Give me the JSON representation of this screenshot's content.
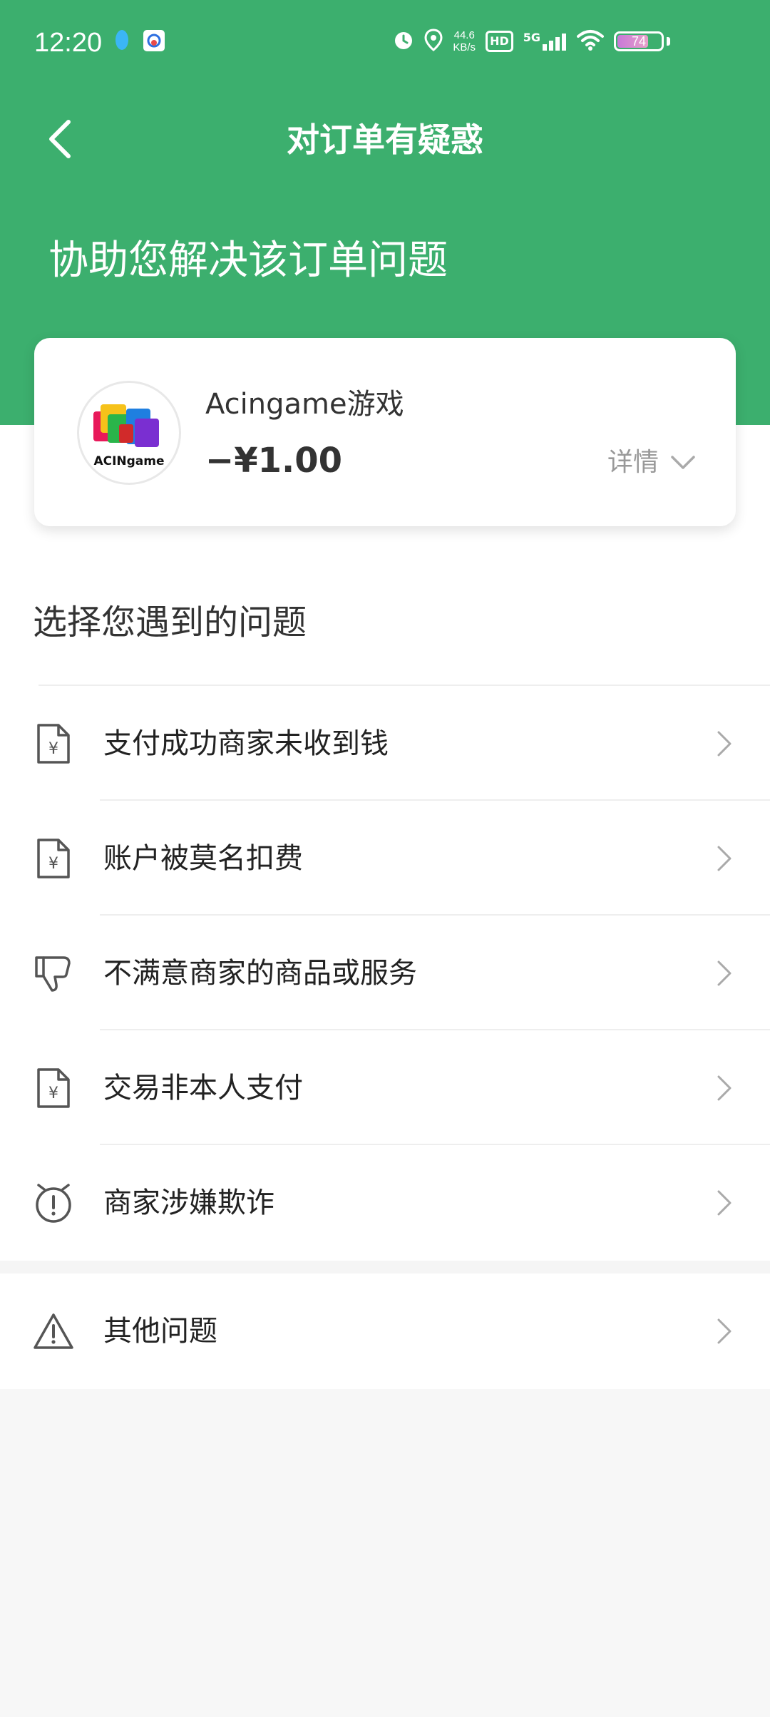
{
  "status_bar": {
    "time": "12:20",
    "net_speed_value": "44.6",
    "net_speed_unit": "KB/s",
    "hd_label": "HD",
    "network_label": "5G",
    "battery_level": "74",
    "battery_fraction": 0.74
  },
  "header": {
    "title": "对订单有疑惑",
    "subtitle": "协助您解决该订单问题",
    "color": "#3caf6e"
  },
  "order_card": {
    "merchant_name": "Acingame游戏",
    "amount": "−¥1.00",
    "details_label": "详情",
    "logo_text": "ACINgame"
  },
  "section_heading": "选择您遇到的问题",
  "issues": [
    {
      "label": "支付成功商家未收到钱",
      "icon": "yuan-document-icon"
    },
    {
      "label": "账户被莫名扣费",
      "icon": "yuan-document-icon"
    },
    {
      "label": "不满意商家的商品或服务",
      "icon": "thumbs-down-icon"
    },
    {
      "label": "交易非本人支付",
      "icon": "yuan-document-icon"
    },
    {
      "label": "商家涉嫌欺诈",
      "icon": "alarm-exclamation-icon"
    }
  ],
  "other_issue": {
    "label": "其他问题",
    "icon": "warning-triangle-icon"
  }
}
